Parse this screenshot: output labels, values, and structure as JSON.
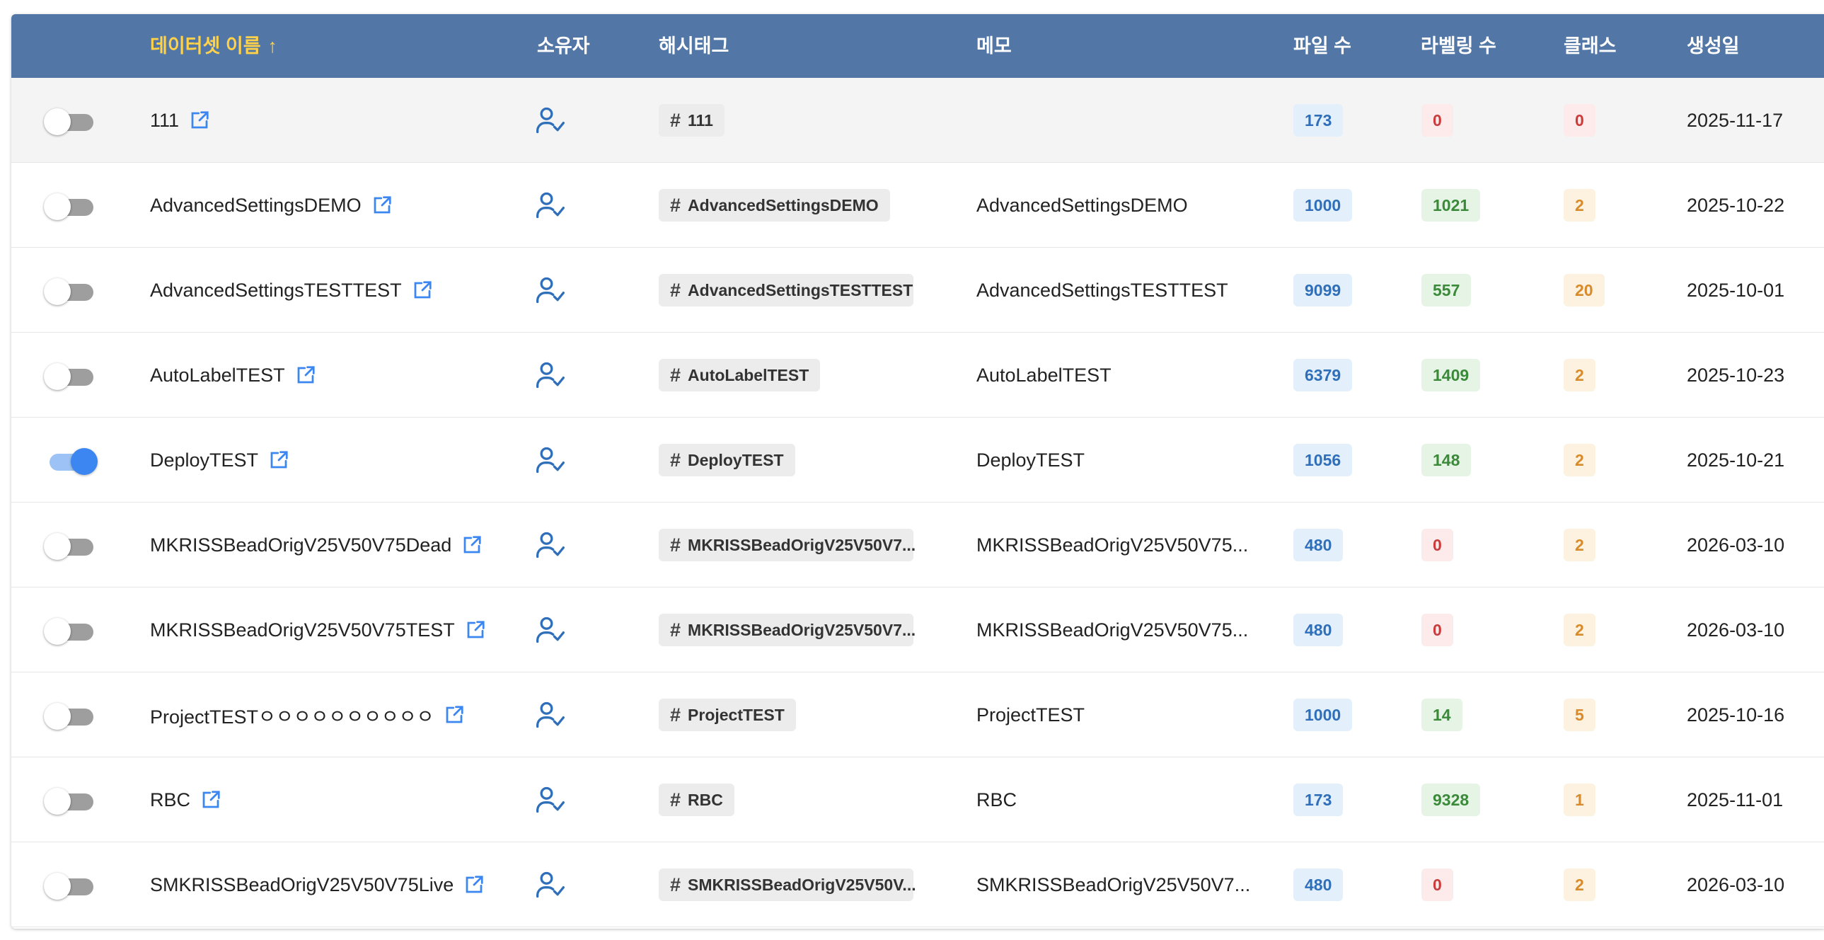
{
  "header": {
    "name": "데이터셋 이름",
    "sort_arrow": "↑",
    "owner": "소유자",
    "hashtag": "해시태그",
    "memo": "메모",
    "files": "파일 수",
    "labels": "라벨링 수",
    "classes": "클래스",
    "created": "생성일"
  },
  "colors": {
    "header_bg": "#5277a6",
    "sorted_header": "#ffd24a",
    "accent_blue": "#3b86f0"
  },
  "icons": {
    "external": "external-link-icon",
    "owner": "user-check-icon",
    "hashtag": "hash-icon"
  },
  "rows": [
    {
      "active": false,
      "name": "111",
      "hashtag": "111",
      "memo": "",
      "files": "173",
      "labels": "0",
      "classes": "0",
      "created": "2025-11-17"
    },
    {
      "active": false,
      "name": "AdvancedSettingsDEMO",
      "hashtag": "AdvancedSettingsDEMO",
      "memo": "AdvancedSettingsDEMO",
      "files": "1000",
      "labels": "1021",
      "classes": "2",
      "created": "2025-10-22"
    },
    {
      "active": false,
      "name": "AdvancedSettingsTESTTEST",
      "hashtag": "AdvancedSettingsTESTTEST",
      "memo": "AdvancedSettingsTESTTEST",
      "files": "9099",
      "labels": "557",
      "classes": "20",
      "created": "2025-10-01"
    },
    {
      "active": false,
      "name": "AutoLabelTEST",
      "hashtag": "AutoLabelTEST",
      "memo": "AutoLabelTEST",
      "files": "6379",
      "labels": "1409",
      "classes": "2",
      "created": "2025-10-23"
    },
    {
      "active": true,
      "name": "DeployTEST",
      "hashtag": "DeployTEST",
      "memo": "DeployTEST",
      "files": "1056",
      "labels": "148",
      "classes": "2",
      "created": "2025-10-21"
    },
    {
      "active": false,
      "name": "MKRISSBeadOrigV25V50V75Dead",
      "hashtag": "MKRISSBeadOrigV25V50V7...",
      "memo": "MKRISSBeadOrigV25V50V75...",
      "files": "480",
      "labels": "0",
      "classes": "2",
      "created": "2026-03-10"
    },
    {
      "active": false,
      "name": "MKRISSBeadOrigV25V50V75TEST",
      "hashtag": "MKRISSBeadOrigV25V50V7...",
      "memo": "MKRISSBeadOrigV25V50V75...",
      "files": "480",
      "labels": "0",
      "classes": "2",
      "created": "2026-03-10"
    },
    {
      "active": false,
      "name": "ProjectTESTㅇㅇㅇㅇㅇㅇㅇㅇㅇㅇ",
      "hashtag": "ProjectTEST",
      "memo": "ProjectTEST",
      "files": "1000",
      "labels": "14",
      "classes": "5",
      "created": "2025-10-16"
    },
    {
      "active": false,
      "name": "RBC",
      "hashtag": "RBC",
      "memo": "RBC",
      "files": "173",
      "labels": "9328",
      "classes": "1",
      "created": "2025-11-01"
    },
    {
      "active": false,
      "name": "SMKRISSBeadOrigV25V50V75Live",
      "hashtag": "SMKRISSBeadOrigV25V50V...",
      "memo": "SMKRISSBeadOrigV25V50V7...",
      "files": "480",
      "labels": "0",
      "classes": "2",
      "created": "2026-03-10"
    }
  ]
}
